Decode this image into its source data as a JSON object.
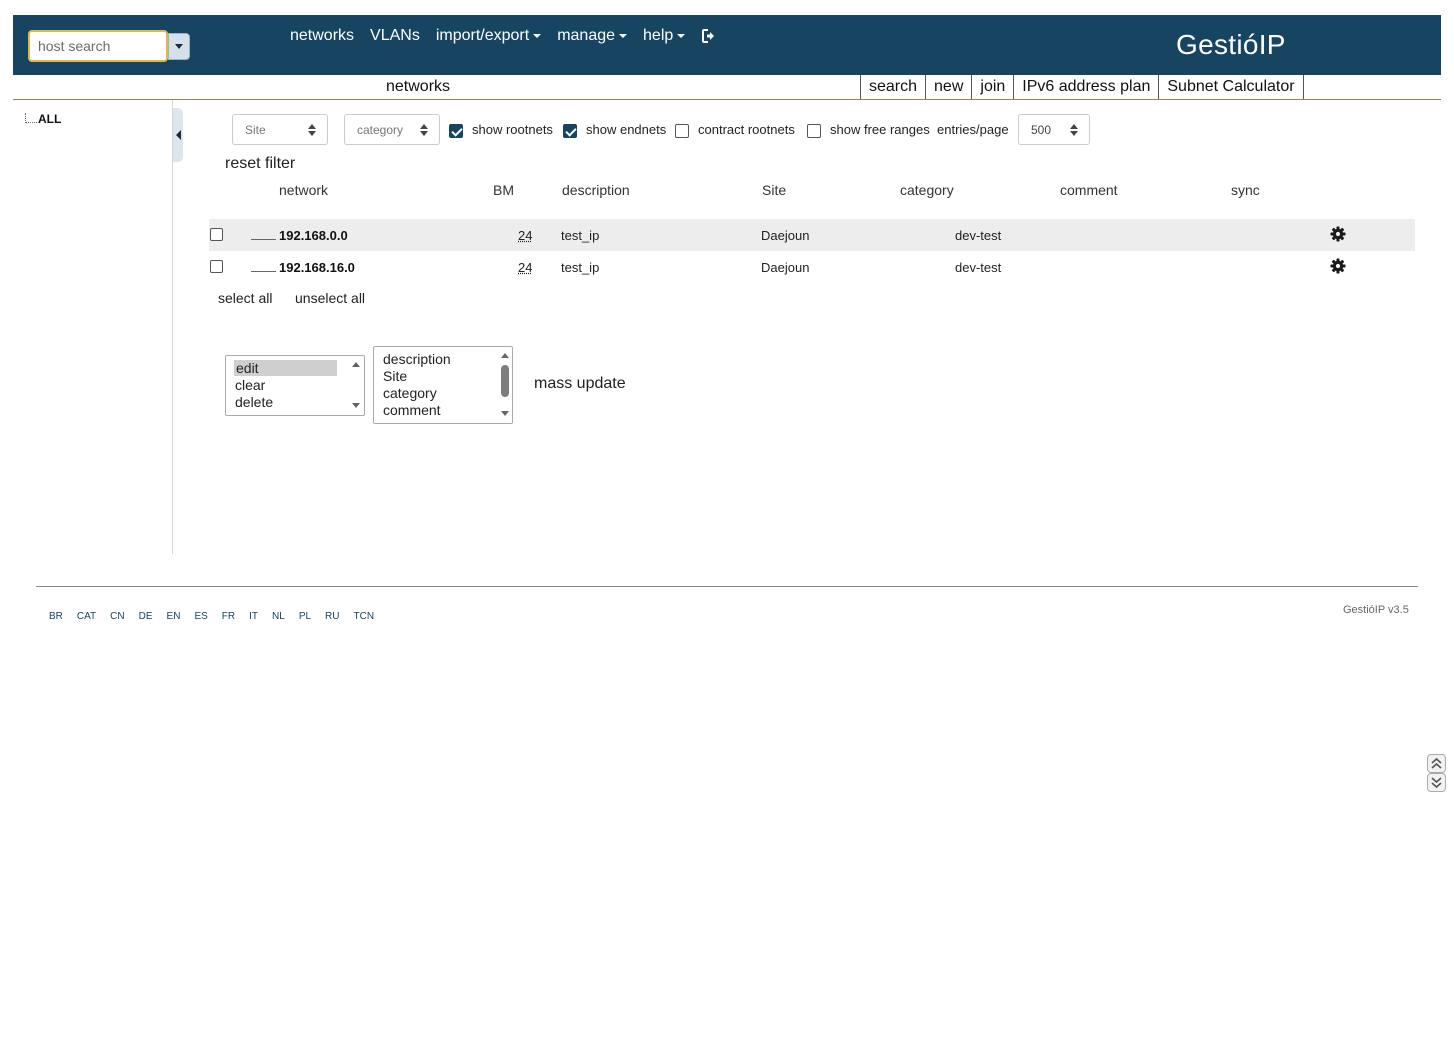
{
  "header": {
    "search_placeholder": "host search",
    "nav": [
      {
        "label": "networks"
      },
      {
        "label": "VLANs"
      },
      {
        "label": "import/export"
      },
      {
        "label": "manage"
      },
      {
        "label": "help"
      }
    ],
    "brand": "GestióIP"
  },
  "subbar": {
    "title": "networks",
    "items": [
      "search",
      "new",
      "join",
      "IPv6 address plan",
      "Subnet Calculator"
    ]
  },
  "tree": {
    "root": "ALL"
  },
  "filters": {
    "site_select": "Site",
    "category_select": "category",
    "show_rootnets": {
      "label": "show rootnets",
      "checked": true
    },
    "show_endnets": {
      "label": "show endnets",
      "checked": true
    },
    "contract_rootnets": {
      "label": "contract rootnets",
      "checked": false
    },
    "show_free_ranges": {
      "label": "show free ranges",
      "checked": false
    },
    "entries_label": "entries/page",
    "entries_value": "500",
    "reset": "reset filter"
  },
  "table": {
    "headers": [
      "network",
      "BM",
      "description",
      "Site",
      "category",
      "comment",
      "sync"
    ],
    "rows": [
      {
        "network": "192.168.0.0",
        "bm": "24",
        "description": "test_ip",
        "site": "Daejoun",
        "category": "dev-test",
        "comment": ""
      },
      {
        "network": "192.168.16.0",
        "bm": "24",
        "description": "test_ip",
        "site": "Daejoun",
        "category": "dev-test",
        "comment": ""
      }
    ]
  },
  "selection": {
    "select_all": "select all",
    "unselect_all": "unselect all"
  },
  "actions": {
    "options": [
      "edit",
      "clear",
      "delete"
    ],
    "selected": "edit",
    "fields": [
      "description",
      "Site",
      "category",
      "comment"
    ],
    "mass_update": "mass update"
  },
  "footer": {
    "languages": [
      "BR",
      "CAT",
      "CN",
      "DE",
      "EN",
      "ES",
      "FR",
      "IT",
      "NL",
      "PL",
      "RU",
      "TCN"
    ],
    "version": "GestióIP v3.5"
  },
  "colors": {
    "header_bg": "#164461",
    "accent_border": "#e0b84a",
    "divider": "#a08052"
  }
}
